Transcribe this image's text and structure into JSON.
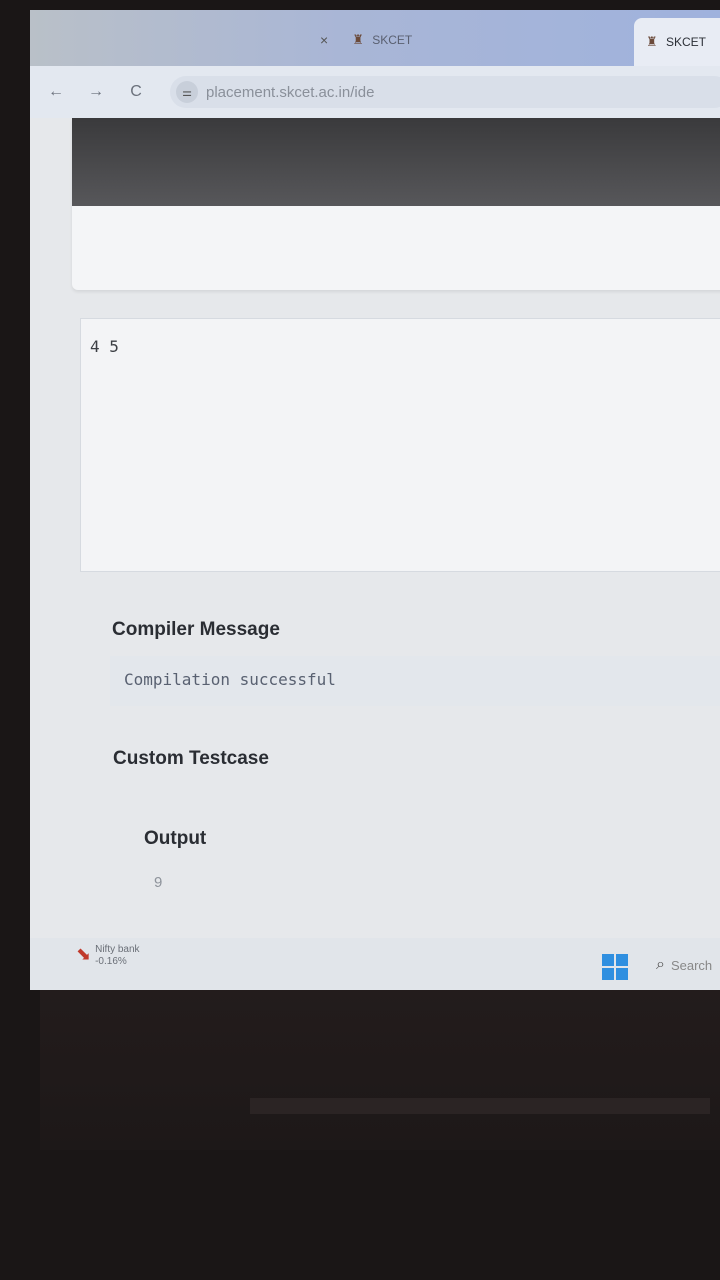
{
  "browser": {
    "tabs": [
      {
        "title": "SKCET",
        "state": "inactive"
      },
      {
        "title": "SKCET",
        "state": "active"
      }
    ],
    "url": "placement.skcet.ac.in/ide",
    "close_glyph": "×",
    "nav": {
      "back": "←",
      "forward": "→",
      "reload": "C"
    }
  },
  "ide": {
    "input_text": "4 5",
    "compiler_message_title": "Compiler Message",
    "compiler_message": "Compilation successful",
    "custom_testcase_title": "Custom Testcase",
    "output_title": "Output",
    "output_value": "9"
  },
  "taskbar": {
    "widget_title": "Nifty bank",
    "widget_value": "-0.16%",
    "search_placeholder": "Search"
  },
  "colors": {
    "windows_blue": "#2f8fe0",
    "widget_red": "#c0392b"
  }
}
